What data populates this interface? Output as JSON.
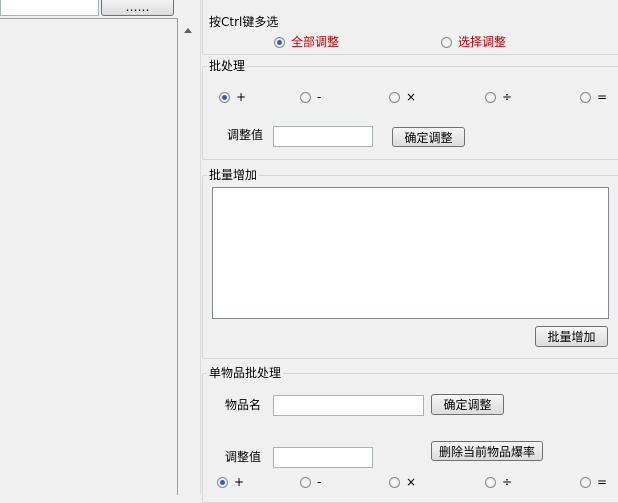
{
  "top": {
    "more_button": "……"
  },
  "header": {
    "hint": "按Ctrl键多选",
    "options": [
      {
        "label": "全部调整",
        "checked": true
      },
      {
        "label": "选择调整",
        "checked": false
      }
    ]
  },
  "batch": {
    "title": "批处理",
    "operators": [
      {
        "label": "+",
        "checked": true
      },
      {
        "label": "-",
        "checked": false
      },
      {
        "label": "×",
        "checked": false
      },
      {
        "label": "÷",
        "checked": false
      },
      {
        "label": "=",
        "checked": false
      }
    ],
    "adjust_label": "调整值",
    "adjust_value": "",
    "confirm_button": "确定调整"
  },
  "bulk_add": {
    "title": "批量增加",
    "text": "",
    "add_button": "批量增加"
  },
  "single": {
    "title": "单物品批处理",
    "item_label": "物品名",
    "item_value": "",
    "confirm_button": "确定调整",
    "adjust_label": "调整值",
    "adjust_value": "",
    "delete_button": "删除当前物品爆率",
    "operators": [
      {
        "label": "+",
        "checked": true
      },
      {
        "label": "-",
        "checked": false
      },
      {
        "label": "×",
        "checked": false
      },
      {
        "label": "÷",
        "checked": false
      },
      {
        "label": "=",
        "checked": false
      }
    ]
  }
}
